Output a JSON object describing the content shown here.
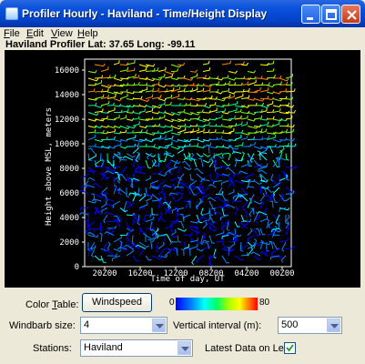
{
  "window": {
    "title": "Profiler Hourly - Haviland - Time/Height Display"
  },
  "menu": [
    {
      "accel": "F",
      "rest": "ile"
    },
    {
      "accel": "E",
      "rest": "dit"
    },
    {
      "accel": "V",
      "rest": "iew"
    },
    {
      "accel": "H",
      "rest": "elp"
    }
  ],
  "station_info": "Haviland Profiler Lat: 37.65  Long: -99.11",
  "chart": {
    "type": "wind-barb time-height",
    "ylabel": "Height above MSL, meters",
    "xlabel": "Time of day, UT",
    "y_ticks": [
      "0",
      "2000",
      "4000",
      "6000",
      "8000",
      "10000",
      "12000",
      "14000",
      "16000"
    ],
    "x_ticks": [
      "20Z00",
      "16Z00",
      "12Z00",
      "08Z00",
      "04Z00",
      "00Z00"
    ]
  },
  "chart_data": {
    "type": "scatter",
    "xlabel": "Time of day, UT",
    "ylabel": "Height above MSL, meters",
    "ylim": [
      0,
      16000
    ],
    "x_categories": [
      "20Z00",
      "16Z00",
      "12Z00",
      "08Z00",
      "04Z00",
      "00Z00"
    ],
    "y_ticks": [
      0,
      2000,
      4000,
      6000,
      8000,
      10000,
      12000,
      14000,
      16000
    ],
    "speed_colors": [
      "#0000ff",
      "#0088ff",
      "#00ffff",
      "#00ff88",
      "#88ff00",
      "#ffff00",
      "#ff8800",
      "#ff0000"
    ]
  },
  "controls": {
    "color_table_label": "Color Table:",
    "color_table_accel": "T",
    "color_table_button": "Windspeed",
    "colorbar_min": "0",
    "colorbar_max": "80",
    "windbarb_label": "Windbarb size:",
    "windbarb_value": "4",
    "vinterval_label": "Vertical interval (m):",
    "vinterval_value": "500",
    "stations_label": "Stations:",
    "stations_value": "Haviland",
    "latest_left_label": "Latest Data on Left:",
    "latest_left_checked": true
  }
}
